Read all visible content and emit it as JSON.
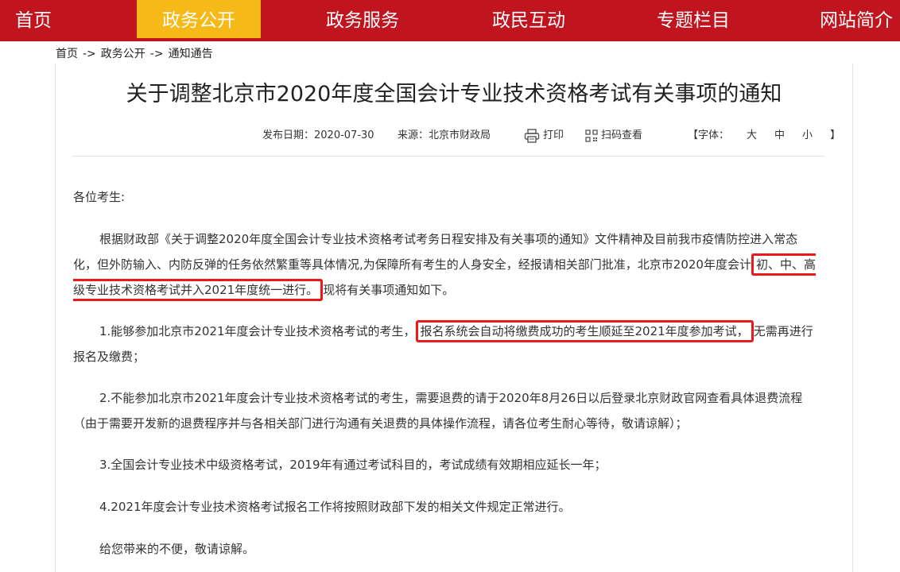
{
  "nav": {
    "items": [
      {
        "label": "首页"
      },
      {
        "label": "政务公开"
      },
      {
        "label": "政务服务"
      },
      {
        "label": "政民互动"
      },
      {
        "label": "专题栏目"
      },
      {
        "label": "网站简介"
      }
    ],
    "active_index": 1
  },
  "breadcrumb": {
    "items": [
      "首页",
      "政务公开",
      "通知通告"
    ],
    "separator": "->"
  },
  "article": {
    "title": "关于调整北京市2020年度全国会计专业技术资格考试有关事项的通知",
    "meta": {
      "date_label": "发布日期：",
      "date": "2020-07-30",
      "source_label": "来源：",
      "source": "北京市财政局",
      "print_label": "打印",
      "scan_label": "扫码查看",
      "font_open": "【字体：",
      "font_large": "大",
      "font_medium": "中",
      "font_small": "小",
      "font_close": "】"
    },
    "greeting": "各位考生:",
    "p1": {
      "a": "根据财政部《关于调整2020年度全国会计专业技术资格考试考务日程安排及有关事项的通知》文件精神及目前我市疫情防控进入常态化，但外防输入、内防反弹的任务依然繁重等具体情况,为保障所有考生的人身安全，经报请相关部门批准，北京市2020年度会计",
      "highlight": "初、中、高级专业技术资格考试并入2021年度统一进行。",
      "b": "现将有关事项通知如下。"
    },
    "p2": {
      "a": "1.能够参加北京市2021年度会计专业技术资格考试的考生，",
      "highlight": "报名系统会自动将缴费成功的考生顺延至2021年度参加考试，",
      "b": "无需再进行报名及缴费；"
    },
    "p3": "2.不能参加北京市2021年度会计专业技术资格考试的考生，需要退费的请于2020年8月26日以后登录北京财政官网查看具体退费流程（由于需要开发新的退费程序并与各相关部门进行沟通有关退费的具体操作流程，请各位考生耐心等待，敬请谅解）；",
    "p4": "3.全国会计专业技术中级资格考试，2019年有通过考试科目的，考试成绩有效期相应延长一年；",
    "p5": "4.2021年度会计专业技术资格考试报名工作将按照财政部下发的相关文件规定正常进行。",
    "p6": "给您带来的不便，敬请谅解。"
  },
  "colors": {
    "nav_bg": "#c0141f",
    "nav_active": "#f6b918",
    "highlight_border": "#ea1a1a"
  }
}
